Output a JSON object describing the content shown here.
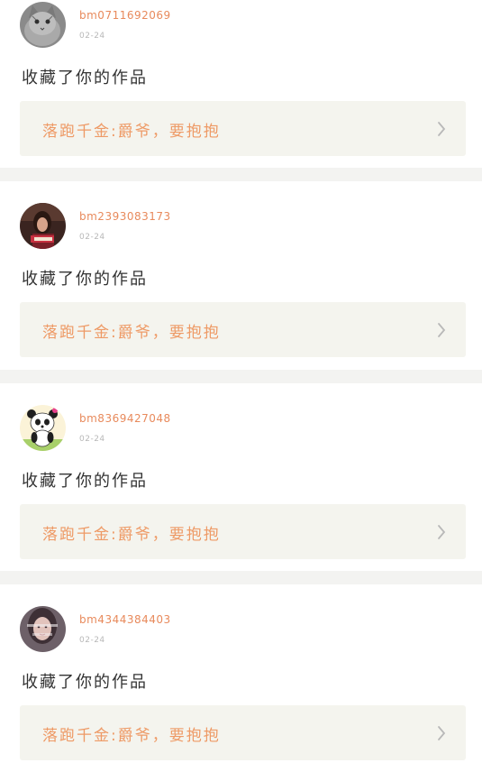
{
  "notifications": [
    {
      "username": "bm0711692069",
      "date": "02-24",
      "action": "收藏了你的作品",
      "work_title": "落跑千金:爵爷，要抱抱",
      "avatar_icon": "cat-avatar-icon"
    },
    {
      "username": "bm2393083173",
      "date": "02-24",
      "action": "收藏了你的作品",
      "work_title": "落跑千金:爵爷，要抱抱",
      "avatar_icon": "girl-photo-avatar-icon"
    },
    {
      "username": "bm8369427048",
      "date": "02-24",
      "action": "收藏了你的作品",
      "work_title": "落跑千金:爵爷，要抱抱",
      "avatar_icon": "panda-avatar-icon"
    },
    {
      "username": "bm4344384403",
      "date": "02-24",
      "action": "收藏了你的作品",
      "work_title": "落跑千金:爵爷，要抱抱",
      "avatar_icon": "woman-photo-avatar-icon"
    }
  ],
  "colors": {
    "username": "#e88a5c",
    "work_title": "#ee9a66",
    "work_bg": "#f4f4ee",
    "divider": "#f3f3f1"
  }
}
